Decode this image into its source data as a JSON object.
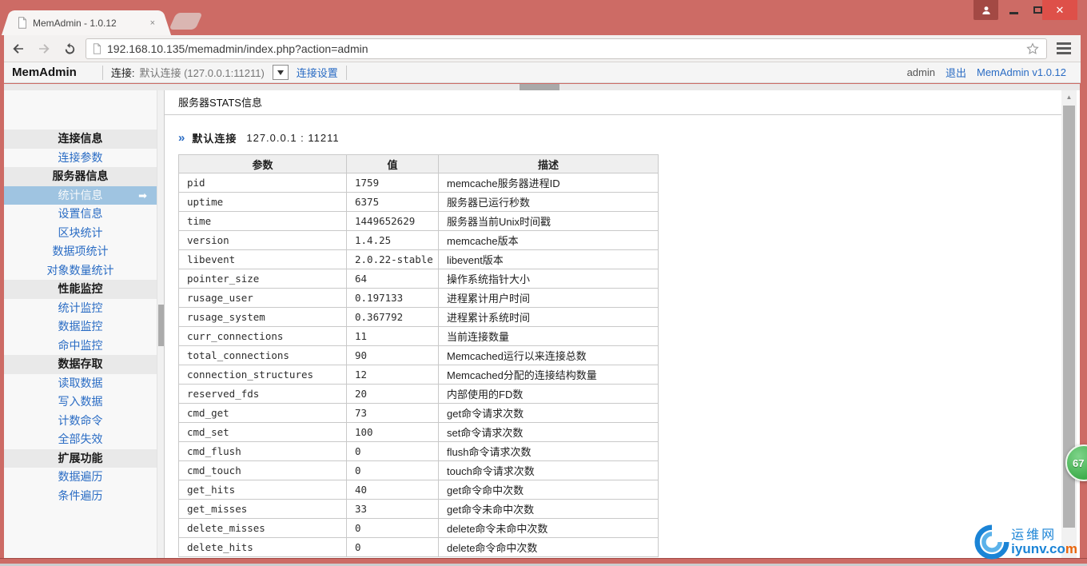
{
  "colors": {
    "accent_blue": "#2a6cc4",
    "frame_red": "#cd6b65",
    "selected_bg": "#9fc4e1",
    "badge_green": "#3fae4c",
    "link_blue": "#1b84d6",
    "watermark_orange": "#e8650d"
  },
  "icons": {
    "tab_close": "×",
    "window_close": "✕",
    "dropdown_arrow": "▼",
    "scroll_up_arrow": "▲",
    "selected_arrow": "➡",
    "heading_marker": "»"
  },
  "browser": {
    "tab_title": "MemAdmin - 1.0.12",
    "url": "192.168.10.135/memadmin/index.php?action=admin"
  },
  "header": {
    "brand": "MemAdmin",
    "connection_label": "连接:",
    "connection_value": "默认连接 (127.0.0.1:11211)",
    "connection_settings": "连接设置",
    "user": "admin",
    "logout": "退出",
    "version_link": "MemAdmin v1.0.12"
  },
  "sidebar": {
    "items": [
      {
        "label": "连接信息",
        "type": "section"
      },
      {
        "label": "连接参数",
        "type": "link"
      },
      {
        "label": "服务器信息",
        "type": "section"
      },
      {
        "label": "统计信息",
        "type": "link",
        "selected": true
      },
      {
        "label": "设置信息",
        "type": "link"
      },
      {
        "label": "区块统计",
        "type": "link"
      },
      {
        "label": "数据项统计",
        "type": "link"
      },
      {
        "label": "对象数量统计",
        "type": "link"
      },
      {
        "label": "性能监控",
        "type": "section"
      },
      {
        "label": "统计监控",
        "type": "link"
      },
      {
        "label": "数据监控",
        "type": "link"
      },
      {
        "label": "命中监控",
        "type": "link"
      },
      {
        "label": "数据存取",
        "type": "section"
      },
      {
        "label": "读取数据",
        "type": "link"
      },
      {
        "label": "写入数据",
        "type": "link"
      },
      {
        "label": "计数命令",
        "type": "link"
      },
      {
        "label": "全部失效",
        "type": "link"
      },
      {
        "label": "扩展功能",
        "type": "section"
      },
      {
        "label": "数据遍历",
        "type": "link"
      },
      {
        "label": "条件遍历",
        "type": "link"
      }
    ]
  },
  "main": {
    "title": "服务器STATS信息",
    "server_heading": {
      "name": "默认连接",
      "address": "127.0.0.1 : 11211"
    },
    "table": {
      "headers": [
        "参数",
        "值",
        "描述"
      ],
      "rows": [
        {
          "param": "pid",
          "value": "1759",
          "desc": "memcache服务器进程ID"
        },
        {
          "param": "uptime",
          "value": "6375",
          "desc": "服务器已运行秒数"
        },
        {
          "param": "time",
          "value": "1449652629",
          "desc": "服务器当前Unix时间戳"
        },
        {
          "param": "version",
          "value": "1.4.25",
          "desc": "memcache版本"
        },
        {
          "param": "libevent",
          "value": "2.0.22-stable",
          "desc": "libevent版本"
        },
        {
          "param": "pointer_size",
          "value": "64",
          "desc": "操作系统指针大小"
        },
        {
          "param": "rusage_user",
          "value": "0.197133",
          "desc": "进程累计用户时间"
        },
        {
          "param": "rusage_system",
          "value": "0.367792",
          "desc": "进程累计系统时间"
        },
        {
          "param": "curr_connections",
          "value": "11",
          "desc": "当前连接数量"
        },
        {
          "param": "total_connections",
          "value": "90",
          "desc": "Memcached运行以来连接总数"
        },
        {
          "param": "connection_structures",
          "value": "12",
          "desc": "Memcached分配的连接结构数量"
        },
        {
          "param": "reserved_fds",
          "value": "20",
          "desc": "内部使用的FD数"
        },
        {
          "param": "cmd_get",
          "value": "73",
          "desc": "get命令请求次数"
        },
        {
          "param": "cmd_set",
          "value": "100",
          "desc": "set命令请求次数"
        },
        {
          "param": "cmd_flush",
          "value": "0",
          "desc": "flush命令请求次数"
        },
        {
          "param": "cmd_touch",
          "value": "0",
          "desc": "touch命令请求次数"
        },
        {
          "param": "get_hits",
          "value": "40",
          "desc": "get命令命中次数"
        },
        {
          "param": "get_misses",
          "value": "33",
          "desc": "get命令未命中次数"
        },
        {
          "param": "delete_misses",
          "value": "0",
          "desc": "delete命令未命中次数"
        },
        {
          "param": "delete_hits",
          "value": "0",
          "desc": "delete命令命中次数"
        }
      ]
    }
  },
  "overlays": {
    "badge_count": "67",
    "watermark": {
      "site_name": "运维网",
      "url_main": "iyunv.co",
      "url_accent": "m"
    }
  }
}
